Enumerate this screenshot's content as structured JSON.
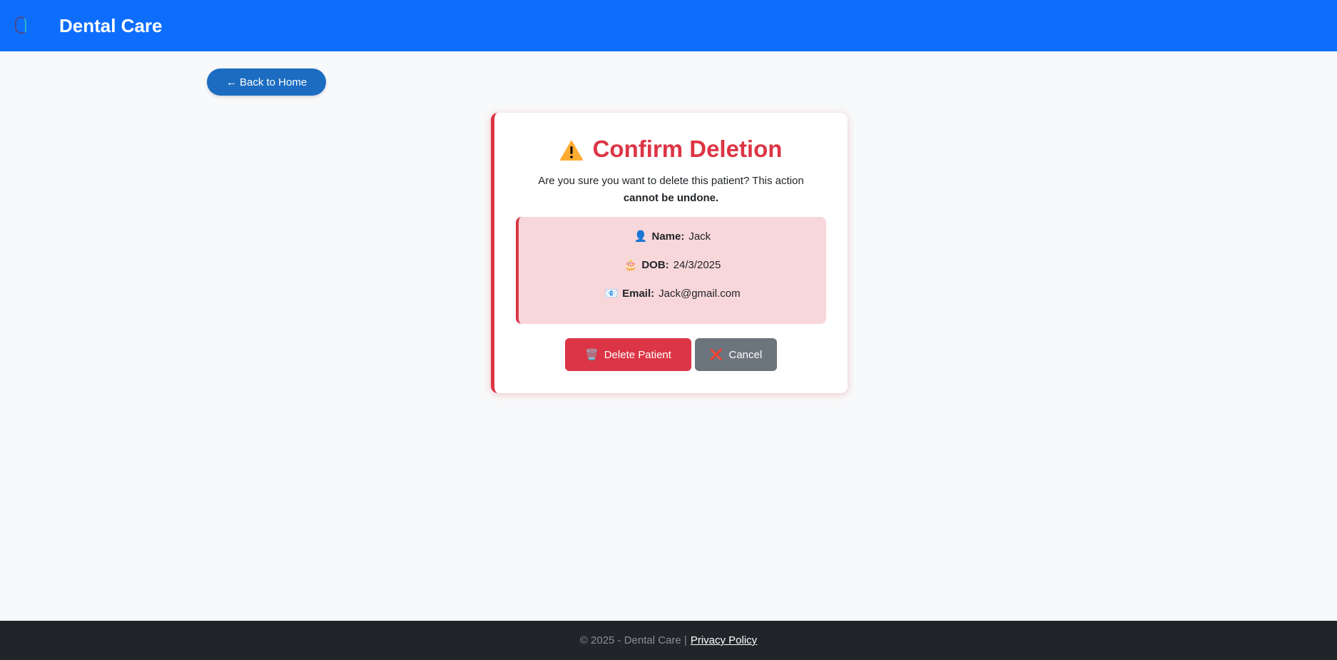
{
  "header": {
    "brand": "Dental Care",
    "logo_text": "Dental Care"
  },
  "back_button": {
    "label": "← Back to Home"
  },
  "dialog": {
    "title": "Confirm Deletion",
    "message": "Are you sure you want to delete this patient? This action",
    "message_bold": "cannot be undone.",
    "patient": {
      "name_label": "Name:",
      "name": "Jack",
      "dob_label": "DOB:",
      "dob": "24/3/2025",
      "email_label": "Email:",
      "email": "Jack@gmail.com"
    },
    "delete_label": "Delete Patient",
    "cancel_label": "Cancel"
  },
  "icons": {
    "name": "👤",
    "dob": "🎂",
    "email": "📧",
    "delete": "🗑️",
    "cancel": "❌"
  },
  "footer": {
    "text": "© 2025 - Dental Care |",
    "link": "Privacy Policy"
  },
  "colors": {
    "primary": "#0d6efd",
    "danger": "#dc3545",
    "secondary": "#6c757d",
    "footer": "#212529"
  }
}
